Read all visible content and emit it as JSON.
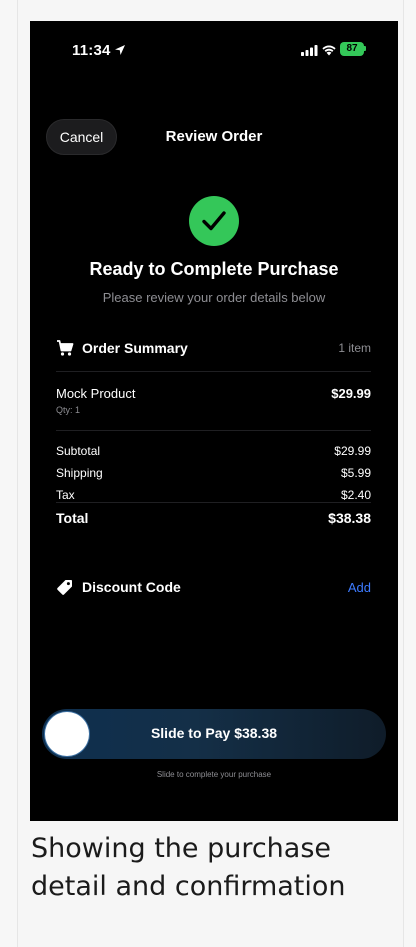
{
  "status_bar": {
    "time": "11:34",
    "battery": "87"
  },
  "header": {
    "cancel_label": "Cancel",
    "title": "Review Order"
  },
  "confirmation": {
    "headline": "Ready to Complete Purchase",
    "subhead": "Please review your order details below"
  },
  "order_summary": {
    "title": "Order Summary",
    "item_count": "1 item",
    "items": [
      {
        "name": "Mock Product",
        "qty": "Qty: 1",
        "price": "$29.99"
      }
    ],
    "breakdown": [
      {
        "label": "Subtotal",
        "value": "$29.99"
      },
      {
        "label": "Shipping",
        "value": "$5.99"
      },
      {
        "label": "Tax",
        "value": "$2.40"
      }
    ],
    "total_label": "Total",
    "total_value": "$38.38"
  },
  "discount": {
    "title": "Discount Code",
    "add_label": "Add"
  },
  "payment": {
    "slider_label": "Slide to Pay $38.38",
    "hint": "Slide to complete your purchase"
  },
  "caption": "Showing the purchase detail and confirmation",
  "colors": {
    "accent_green": "#34c759",
    "link_blue": "#3d7bff",
    "background": "#000000"
  }
}
